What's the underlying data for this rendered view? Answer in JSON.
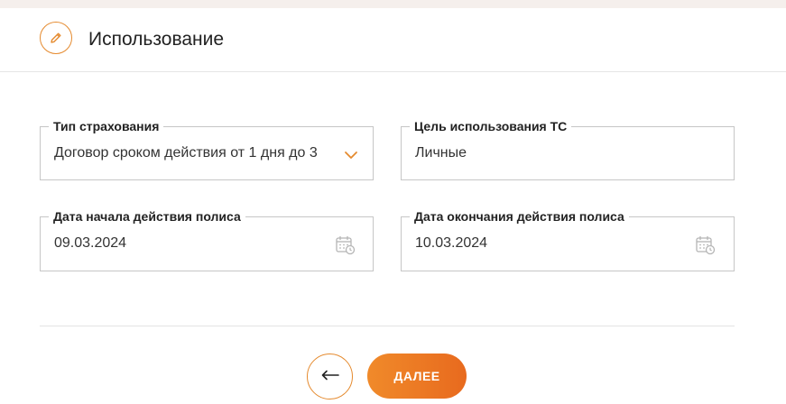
{
  "header": {
    "title": "Использование",
    "icon": "pencil-icon"
  },
  "fields": {
    "insurance_type": {
      "label": "Тип страхования",
      "value": "Договор сроком действия от 1 дня до 3",
      "icon": "chevron-down-icon"
    },
    "purpose": {
      "label": "Цель использования ТС",
      "value": "Личные"
    },
    "start_date": {
      "label": "Дата начала действия полиса",
      "value": "09.03.2024",
      "icon": "calendar-icon"
    },
    "end_date": {
      "label": "Дата окончания действия полиса",
      "value": "10.03.2024",
      "icon": "calendar-icon"
    }
  },
  "buttons": {
    "back_icon": "arrow-left-icon",
    "next_label": "ДАЛЕЕ"
  },
  "colors": {
    "accent": "#e58a2e",
    "button_gradient_start": "#f08a2a",
    "button_gradient_end": "#e86a1e",
    "border": "#c6c6c6"
  }
}
